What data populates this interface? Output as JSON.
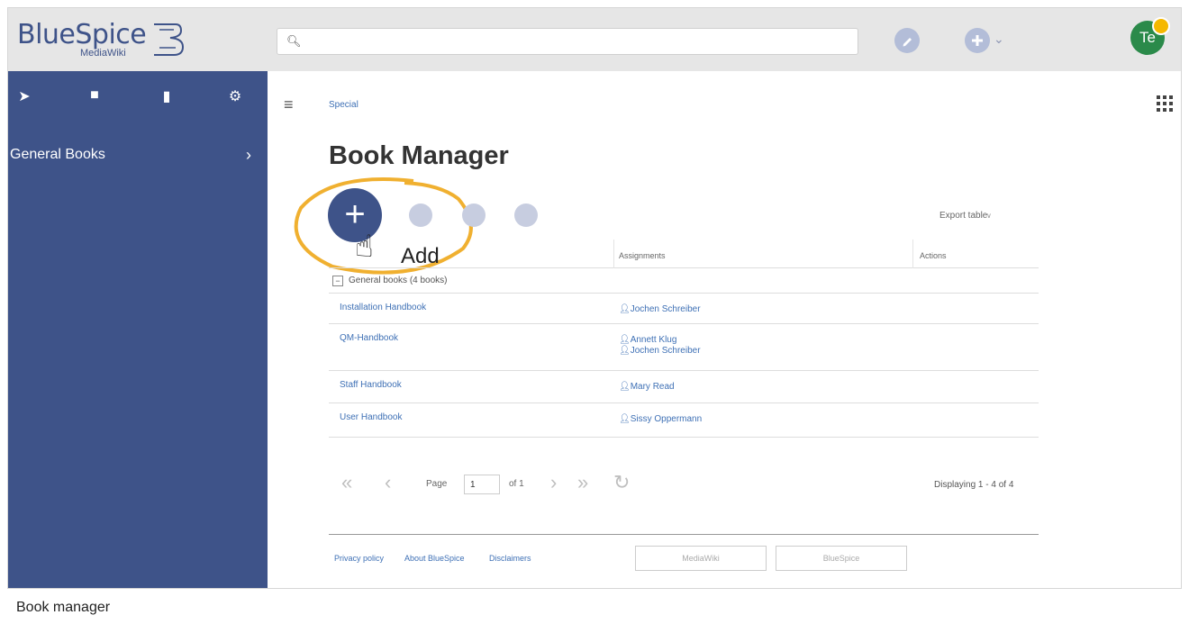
{
  "logo": {
    "main": "BlueSpice",
    "sub": "MediaWiki"
  },
  "search": {
    "value": ""
  },
  "user": {
    "initials": "Te"
  },
  "sidebar": {
    "tabs": [
      {
        "icon": "navigation-icon"
      },
      {
        "icon": "books-icon"
      },
      {
        "icon": "clipboard-icon"
      },
      {
        "icon": "gear-icon"
      }
    ],
    "item_label": "General Books"
  },
  "breadcrumb": "Special",
  "page_title": "Book Manager",
  "toolbar": {
    "add_tooltip": "Add",
    "export_label": "Export table"
  },
  "table": {
    "headers": [
      "Assignments",
      "Actions"
    ],
    "group_label": "General books (4 books)",
    "rows": [
      {
        "title": "Installation Handbook",
        "assignees": [
          "Jochen Schreiber"
        ]
      },
      {
        "title": "QM-Handbook",
        "assignees": [
          "Annett Klug",
          "Jochen Schreiber"
        ]
      },
      {
        "title": "Staff Handbook",
        "assignees": [
          "Mary Read"
        ]
      },
      {
        "title": "User Handbook",
        "assignees": [
          "Sissy Oppermann"
        ]
      }
    ]
  },
  "pager": {
    "page_label": "Page",
    "page_value": "1",
    "of_label": "of 1",
    "displaying": "Displaying 1 - 4 of 4"
  },
  "footer": {
    "links": [
      "Privacy policy",
      "About BlueSpice",
      "Disclaimers"
    ],
    "badges": [
      "MediaWiki",
      "BlueSpice"
    ]
  },
  "caption": "Book manager",
  "colors": {
    "accent": "#3e5389",
    "link": "#3e70b5",
    "highlight_ring": "#f0b030"
  }
}
